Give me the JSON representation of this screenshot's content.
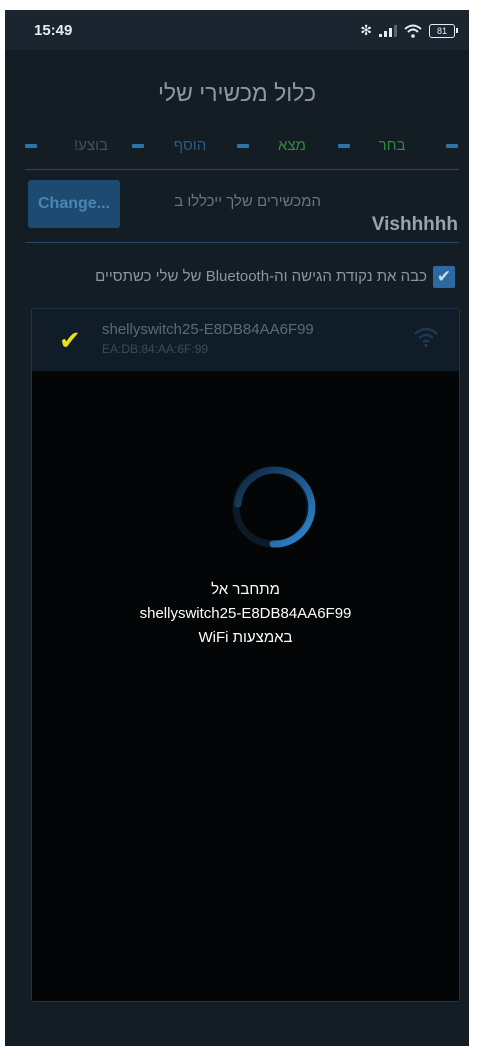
{
  "status_bar": {
    "time": "15:49",
    "battery": "81",
    "icons": [
      "bluetooth-icon",
      "cellular-signal-icon",
      "wifi-icon",
      "battery-icon"
    ]
  },
  "page": {
    "title": "כלול מכשירי שלי"
  },
  "steps": [
    {
      "label": "בחר",
      "state": "done"
    },
    {
      "label": "מצא",
      "state": "done"
    },
    {
      "label": "הוסף",
      "state": "active"
    },
    {
      "label": "בוצע!",
      "state": "todo"
    }
  ],
  "network": {
    "change_label": "Change...",
    "hint": "המכשירים שלך ייכללו ב",
    "name": "Vishhhhh"
  },
  "bluetooth": {
    "checked": true,
    "label": "כבה את נקודת הגישה וה-Bluetooth של שלי כשתסיים"
  },
  "device": {
    "name": "shellyswitch25-E8DB84AA6F99",
    "mac": "EA:DB:84:AA:6F:99",
    "selected": true
  },
  "progress": {
    "line1": "מתחבר אל",
    "line2": "shellyswitch25-E8DB84AA6F99",
    "line3": "באמצעות WiFi"
  },
  "colors": {
    "background": "#141c24",
    "accent": "#2b6aa0",
    "done_step": "#2f8a3b",
    "spinner": "#2e8bd8",
    "check_yellow": "#e5e11d"
  }
}
